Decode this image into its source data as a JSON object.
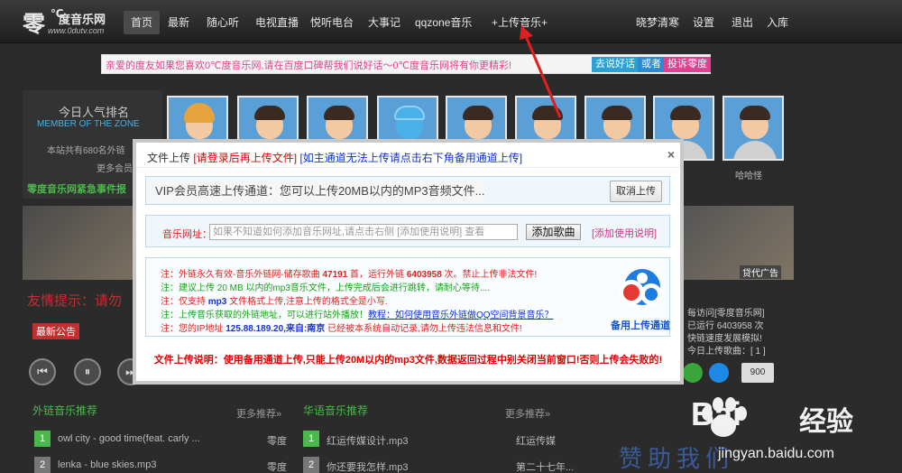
{
  "nav": {
    "logo_char": "零",
    "logo_deg": "℃",
    "logo_name": "度音乐网",
    "logo_url": "www.0dutv.com",
    "items": [
      "首页",
      "最新",
      "随心听",
      "电视直播",
      "悦听电台",
      "大事记",
      "qqzone音乐",
      "+上传音乐+"
    ],
    "right_items": [
      "晓梦清寒",
      "设置",
      "退出",
      "入库"
    ]
  },
  "announce": {
    "text": "亲爱的度友如果您喜欢0℃度音乐网,请在百度口碑帮我们说好话～0℃度音乐网将有你更精彩!",
    "buttons": [
      "去说好话",
      "或者",
      "投诉零度"
    ],
    "colors": [
      "#2aa0d4",
      "#2a8ad4",
      "#e04090"
    ]
  },
  "bg": {
    "ranking_title": "今日人气排名",
    "member_label": "MEMBER OF THE ZONE",
    "count_text": "本站共有680名外链",
    "more_text": "更多会员",
    "event_link": "零度音乐网紧急事件报",
    "user_name": "哈哈怪",
    "notice": "友情提示：请勿",
    "latest": "最新公告",
    "ad": "贷代广告",
    "right_text": [
      "每访问[零度音乐网]",
      "已运行 6403958 次",
      "快链速度发展模拟!",
      "今日上传歌曲：[ 1 ]"
    ],
    "count_badge": "900"
  },
  "lists": {
    "left_title": "外链音乐推荐",
    "left_more": "更多推荐»",
    "right_title": "华语音乐推荐",
    "right_more": "更多推荐»",
    "left_rows": [
      {
        "num": "1",
        "song": "owl city - good time(feat. carly ...",
        "artist": "零度"
      },
      {
        "num": "2",
        "song": "lenka - blue skies.mp3",
        "artist": "零度"
      }
    ],
    "right_rows": [
      {
        "num": "1",
        "song": "红运传媒设计.mp3",
        "artist": "红运传媒"
      },
      {
        "num": "2",
        "song": "你还要我怎样.mp3",
        "artist": "第二十七年..."
      }
    ],
    "sponsor": "赞助我们"
  },
  "dialog": {
    "title": "文件上传",
    "title_red": "[请登录后再上传文件]",
    "title_blue": "[如主通道无法上传请点击右下角备用通道上传]",
    "close": "×",
    "vip_text": "VIP会员高速上传通道：您可以上传20MB以内的MP3音频文件...",
    "cancel_button": "取消上传",
    "url_label": "音乐网址：",
    "url_placeholder": "如果不知道如何添加音乐网址,请点击右侧 [添加使用说明] 查看",
    "add_button": "添加歌曲",
    "add_help": "[添加使用说明]",
    "notes": {
      "n1_a": "注：外链永久有效-音乐外链网-储存歌曲 ",
      "n1_count": "47191",
      "n1_b": " 首，运行外链 ",
      "n1_runs": "6403958",
      "n1_c": " 次。禁止上传非法文件!",
      "n2": "注：建议上传 20 MB 以内的mp3音乐文件，上传完成后会进行跳转，请耐心等待....",
      "n3_a": "注：仅支持 ",
      "n3_fmt": "mp3",
      "n3_b": " 文件格式上传,注意上传的格式全是小写.",
      "n4_a": "注：上传音乐获取的外链地址，可以进行站外播放！",
      "n4_link": "教程：如何使用音乐外链做QQ空间背景音乐？",
      "n5_a": "注：您的IP地址 ",
      "n5_ip": "125.88.189.20,来自:南京",
      "n5_b": " 已经被本系统自动记录,请勿上传违法信息和文件!"
    },
    "backup_label": "备用上传通道",
    "footer": "文件上传说明：使用备用通道上传,只能上传20M以内的mp3文件,数据返回过程中别关闭当前窗口!否则上传会失败的!"
  },
  "watermark": {
    "brand": "Bai",
    "brand2": "经验",
    "url": "jingyan.baidu.com"
  }
}
